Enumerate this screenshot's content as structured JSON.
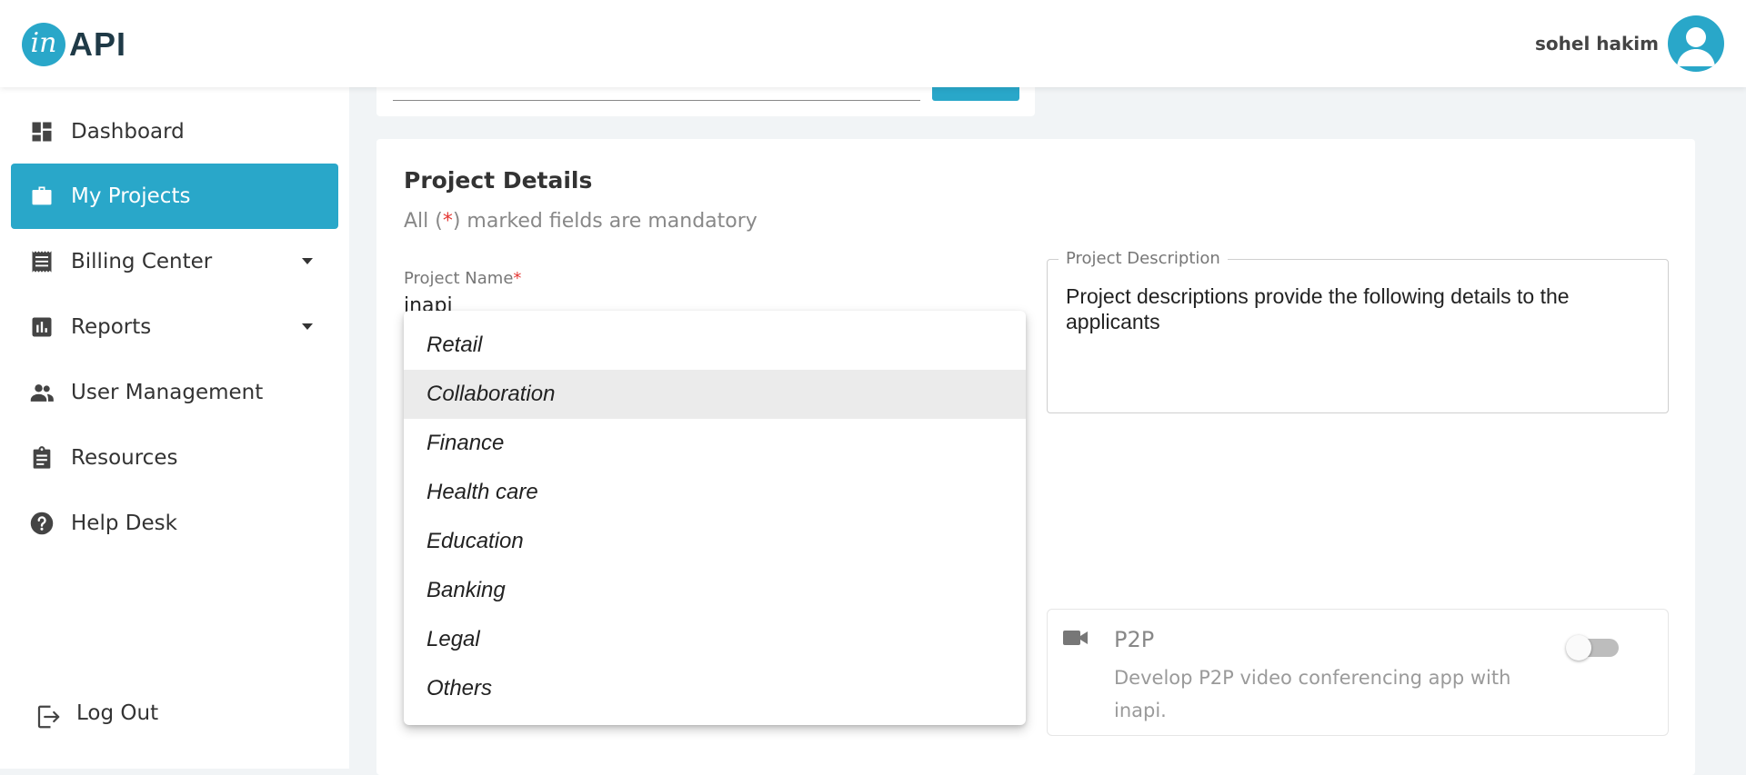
{
  "header": {
    "logo_mark": "in",
    "logo_text": "API",
    "user_name": "sohel hakim"
  },
  "sidebar": {
    "items": [
      {
        "label": "Dashboard",
        "icon": "dashboard-icon"
      },
      {
        "label": "My Projects",
        "icon": "briefcase-icon",
        "active": true
      },
      {
        "label": "Billing Center",
        "icon": "receipt-icon",
        "has_submenu": true
      },
      {
        "label": "Reports",
        "icon": "bar-chart-icon",
        "has_submenu": true
      },
      {
        "label": "User Management",
        "icon": "people-icon"
      },
      {
        "label": "Resources",
        "icon": "clipboard-icon"
      },
      {
        "label": "Help Desk",
        "icon": "help-icon"
      }
    ],
    "logout_label": "Log Out"
  },
  "project": {
    "title": "Project Details",
    "mandatory_prefix": "All (",
    "mandatory_star": "*",
    "mandatory_suffix": ") marked fields are mandatory",
    "name_label": "Project Name",
    "name_star": "*",
    "name_value": "inapi",
    "description_label": "Project Description",
    "description_value": "Project descriptions provide the following details to the applicants"
  },
  "industry_menu": {
    "options": [
      "Retail",
      "Collaboration",
      "Finance",
      "Health care",
      "Education",
      "Banking",
      "Legal",
      "Others"
    ],
    "highlighted": "Collaboration"
  },
  "p2p": {
    "title": "P2P",
    "description": "Develop P2P video conferencing app with inapi.",
    "enabled": false
  },
  "colors": {
    "accent": "#29a7c9",
    "required": "#e53935"
  }
}
